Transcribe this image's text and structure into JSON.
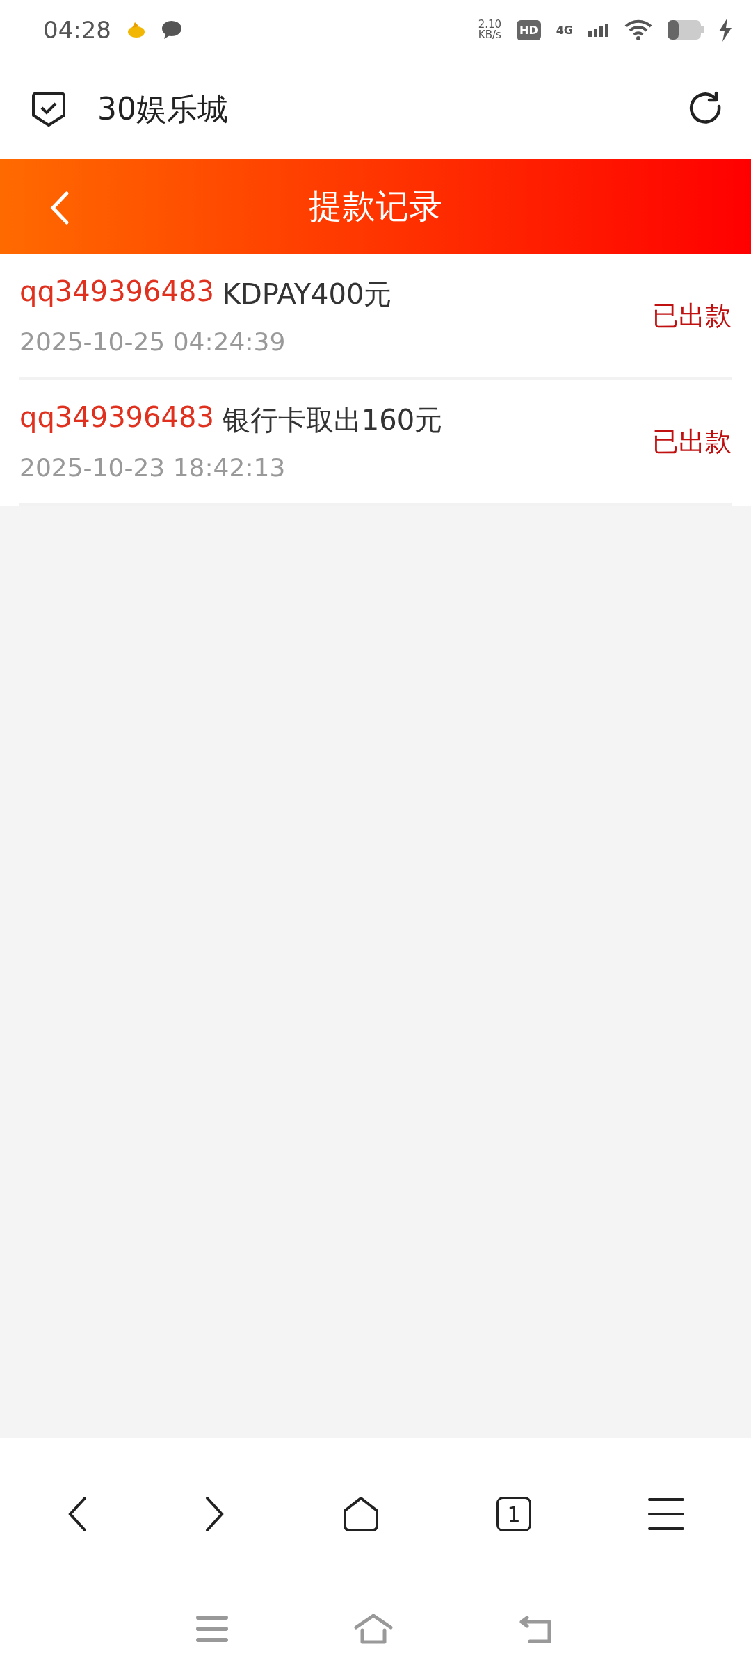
{
  "status_bar": {
    "time": "04:28",
    "net_speed_value": "2.10",
    "net_speed_unit": "KB/s",
    "hd_badge": "HD",
    "network": "4G"
  },
  "browser_bar": {
    "title": "30娱乐城"
  },
  "page_header": {
    "title": "提款记录"
  },
  "records": [
    {
      "account": "qq349396483",
      "description": "KDPAY400元",
      "time": "2025-10-25 04:24:39",
      "status": "已出款"
    },
    {
      "account": "qq349396483",
      "description": "银行卡取出160元",
      "time": "2025-10-23 18:42:13",
      "status": "已出款"
    }
  ],
  "bottom_nav": {
    "tab_count": "1"
  }
}
